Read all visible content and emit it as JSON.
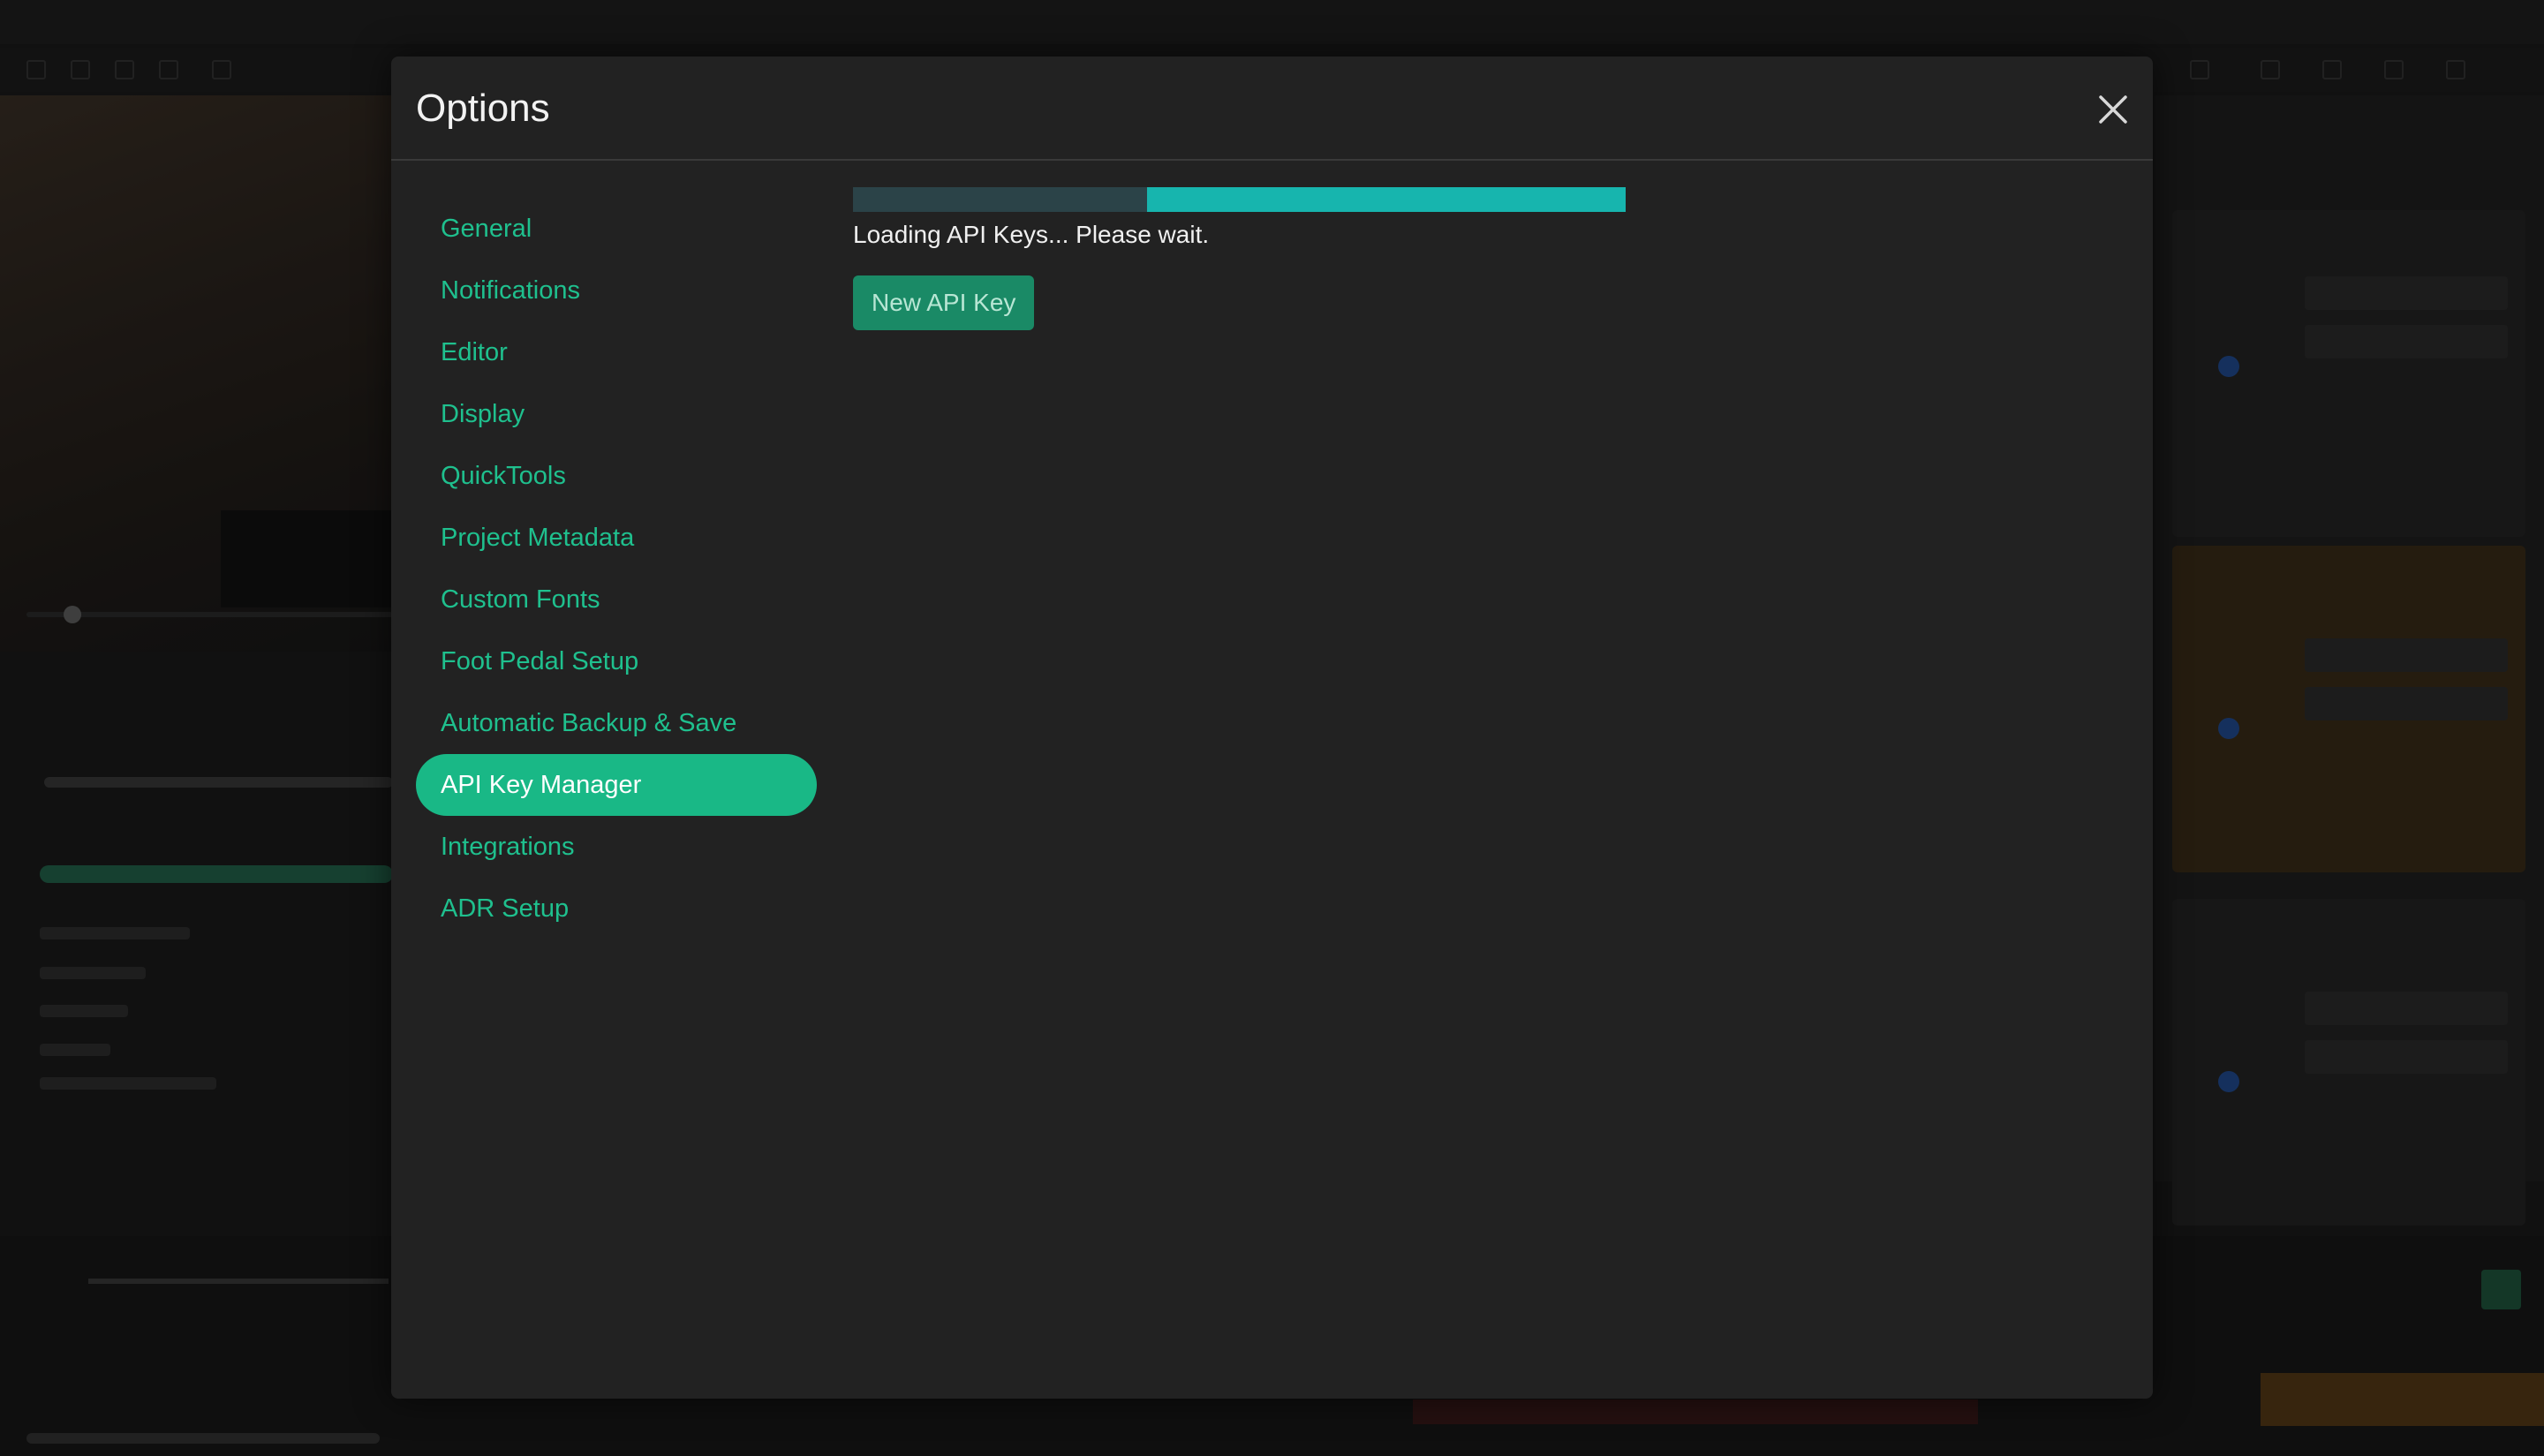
{
  "modal": {
    "title": "Options",
    "close_icon": "close-icon"
  },
  "sidebar": {
    "items": [
      {
        "label": "General",
        "active": false
      },
      {
        "label": "Notifications",
        "active": false
      },
      {
        "label": "Editor",
        "active": false
      },
      {
        "label": "Display",
        "active": false
      },
      {
        "label": "QuickTools",
        "active": false
      },
      {
        "label": "Project Metadata",
        "active": false
      },
      {
        "label": "Custom Fonts",
        "active": false
      },
      {
        "label": "Foot Pedal Setup",
        "active": false
      },
      {
        "label": "Automatic Backup & Save",
        "active": false
      },
      {
        "label": "API Key Manager",
        "active": true
      },
      {
        "label": "Integrations",
        "active": false
      },
      {
        "label": "ADR Setup",
        "active": false
      }
    ]
  },
  "content": {
    "loading_progress": {
      "start_fraction": 0.38,
      "end_fraction": 1.0
    },
    "loading_text": "Loading API Keys... Please wait.",
    "new_key_label": "New API Key"
  },
  "colors": {
    "accent": "#19b886",
    "link": "#1fc08e",
    "progress_fill": "#17b5ae",
    "progress_track": "#2b4348",
    "button": "#1a8a66",
    "modal_bg": "#222222"
  }
}
